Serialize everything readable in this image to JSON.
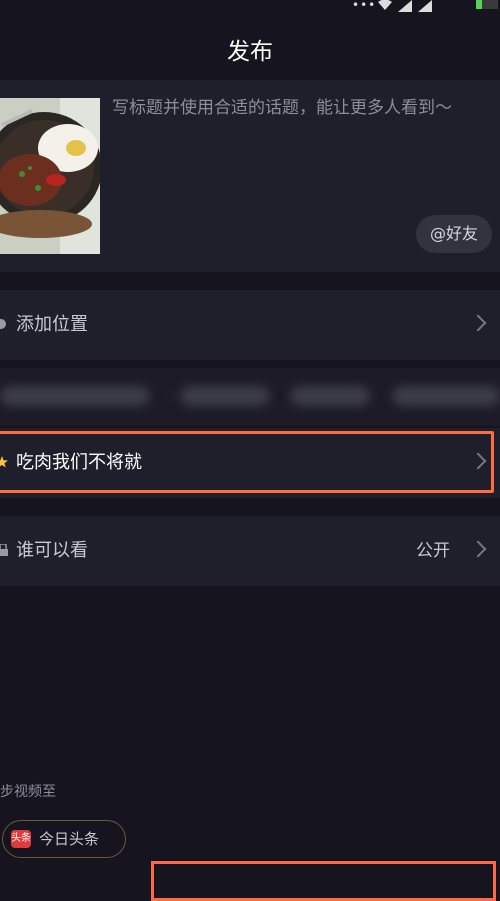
{
  "status_bar": {
    "dots": "•••"
  },
  "header": {
    "title": "发布"
  },
  "post": {
    "placeholder": "写标题并使用合适的话题，能让更多人看到～",
    "friend_button": "@好友"
  },
  "rows": {
    "location": {
      "label": "添加位置"
    },
    "topic": {
      "label": "吃肉我们不将就"
    },
    "visibility": {
      "label": "谁可以看",
      "value": "公开"
    }
  },
  "sync": {
    "label": "同步视频至",
    "toutiao_logo": "头条",
    "toutiao_label": "今日头条"
  },
  "colors": {
    "background": "#15141f",
    "card": "#1f1e2b",
    "highlight": "#ff6a45",
    "accent_star": "#f5c242"
  }
}
